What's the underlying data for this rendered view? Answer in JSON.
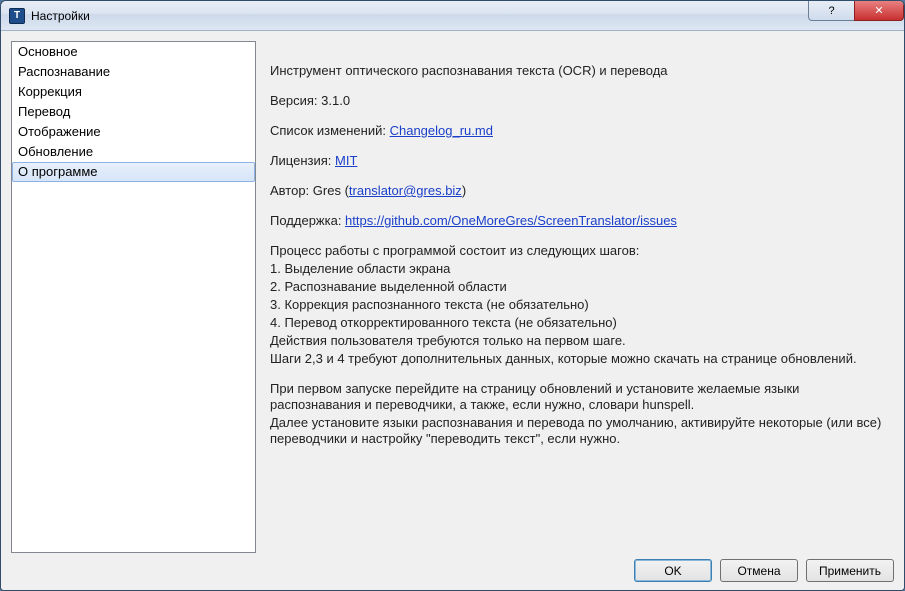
{
  "window": {
    "icon_letter": "T",
    "title": "Настройки"
  },
  "sidebar": {
    "items": [
      {
        "label": "Основное",
        "selected": false
      },
      {
        "label": "Распознавание",
        "selected": false
      },
      {
        "label": "Коррекция",
        "selected": false
      },
      {
        "label": "Перевод",
        "selected": false
      },
      {
        "label": "Отображение",
        "selected": false
      },
      {
        "label": "Обновление",
        "selected": false
      },
      {
        "label": "О программе",
        "selected": true
      }
    ]
  },
  "about": {
    "description": "Инструмент оптического распознавания текста (OCR) и перевода",
    "version_label": "Версия: ",
    "version_value": "3.1.0",
    "changelog_label": "Список изменений: ",
    "changelog_link": "Changelog_ru.md",
    "license_label": "Лицензия: ",
    "license_link": "MIT",
    "author_label": "Автор: Gres (",
    "author_email": "translator@gres.biz",
    "author_tail": ")",
    "support_label": "Поддержка: ",
    "support_link": "https://github.com/OneMoreGres/ScreenTranslator/issues",
    "steps_intro": "Процесс работы с программой состоит из следующих шагов:",
    "steps": [
      "1. Выделение области экрана",
      "2. Распознавание выделенной области",
      "3. Коррекция распознанного текста (не обязательно)",
      "4. Перевод откорректированного текста (не обязательно)"
    ],
    "steps_note1": "Действия пользователя требуются только на первом шаге.",
    "steps_note2": "Шаги 2,3 и 4 требуют дополнительных данных, которые можно скачать на странице обновлений.",
    "first_run1": "При первом запуске перейдите на страницу обновлений и установите желаемые языки распознавания и переводчики, а также, если нужно, словари hunspell.",
    "first_run2": "Далее установите языки распознавания и перевода по умолчанию, активируйте некоторые (или все) переводчики и настройку \"переводить текст\", если нужно."
  },
  "buttons": {
    "ok": "OK",
    "cancel": "Отмена",
    "apply": "Применить"
  }
}
